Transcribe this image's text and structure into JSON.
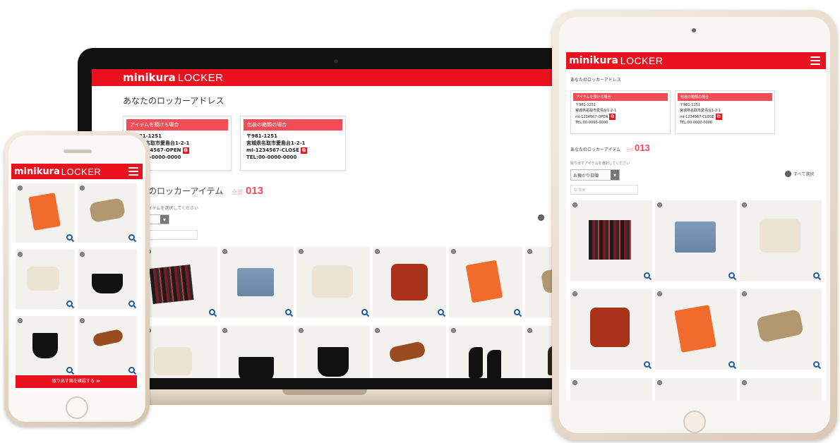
{
  "app": {
    "logo_bold": "minikura",
    "logo_light": "LOCKER"
  },
  "laptop": {
    "page_title": "あなたのロッカーアドレス",
    "address_left": {
      "header": "アイテムを預ける場合",
      "lines": [
        "〒981-1251",
        "宮城県名取市愛島台1-2-1",
        "mI-1234567-OPEN",
        "TEL:00-0000-0000"
      ]
    },
    "address_right": {
      "header": "包装の箱類の場合",
      "lines": [
        "〒981-1251",
        "宮城県名取市愛島台1-2-1",
        "mI-1234567-CLOSE",
        "TEL:00-0000-0000"
      ]
    },
    "section_title": "あなたのロッカーアイテム",
    "count_label": "全部",
    "count": "013",
    "hint": "アイテムを選択してください",
    "sort_value": "",
    "sort_arrow": "▾",
    "search_placeholder": "",
    "select_all": ""
  },
  "tablet": {
    "page_title": "あなたのロッカーアドレス",
    "address_left": {
      "header": "アイテムを預ける場合",
      "lines": [
        "〒981-1251",
        "宮城県名取市愛島台1-2-1",
        "mI-1234567-OPEN",
        "TEL:00-0000-0000"
      ]
    },
    "address_right": {
      "header": "包装の箱類の場合",
      "lines": [
        "〒981-1251",
        "宮城県名取市愛島台1-2-1",
        "mI-1234567-CLOSE",
        "TEL:00-0000-0000"
      ]
    },
    "section_title": "あなたのロッカーアイテム",
    "count_label": "全部",
    "count": "013",
    "hint": "取り出すアイテムを選択してください",
    "sort_value": "お預かり日順",
    "sort_arrow": "▾",
    "search_placeholder": "取 検索",
    "select_all": "すべて選択"
  },
  "phone": {
    "cta": "取り出す箱を確認する ≫"
  },
  "icons": {
    "menu": "hamburger-menu-icon",
    "check": "select-circle-icon",
    "zoom": "zoom-in-icon"
  },
  "colors": {
    "brand_red": "#e8121e",
    "accent_pink": "#f24d57",
    "zoom_blue": "#1d5a9a"
  }
}
